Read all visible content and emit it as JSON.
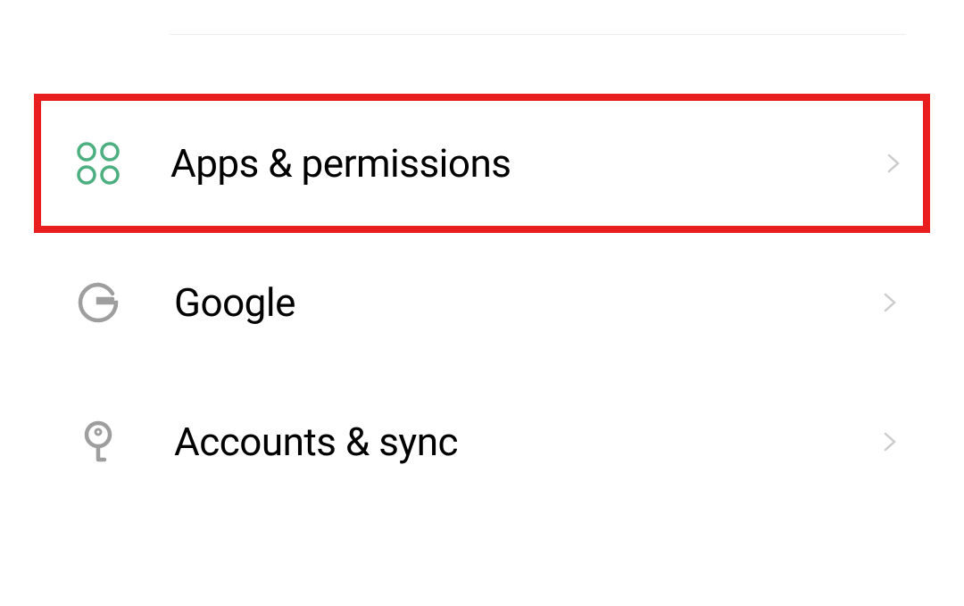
{
  "settings": {
    "items": [
      {
        "label": "Apps & permissions",
        "iconColor": "#4caf7f",
        "highlighted": true
      },
      {
        "label": "Google",
        "iconColor": "#9e9e9e",
        "highlighted": false
      },
      {
        "label": "Accounts & sync",
        "iconColor": "#9e9e9e",
        "highlighted": false
      }
    ]
  },
  "colors": {
    "highlightBorder": "#e91e1e",
    "chevronColor": "#cccccc"
  }
}
